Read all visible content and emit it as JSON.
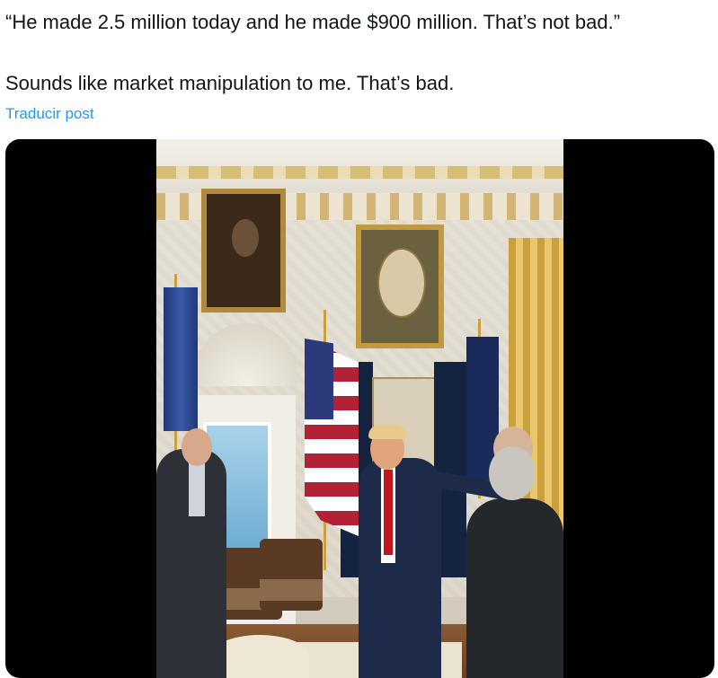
{
  "post": {
    "quote": "“He made 2.5 million today and he made $900 million. That’s not bad.”",
    "comment": "Sounds like market manipulation to me. That’s bad.",
    "translate_link": "Traducir post"
  },
  "colors": {
    "text": "#0f1419",
    "link": "#1d9bf0",
    "media_background": "#000000"
  }
}
